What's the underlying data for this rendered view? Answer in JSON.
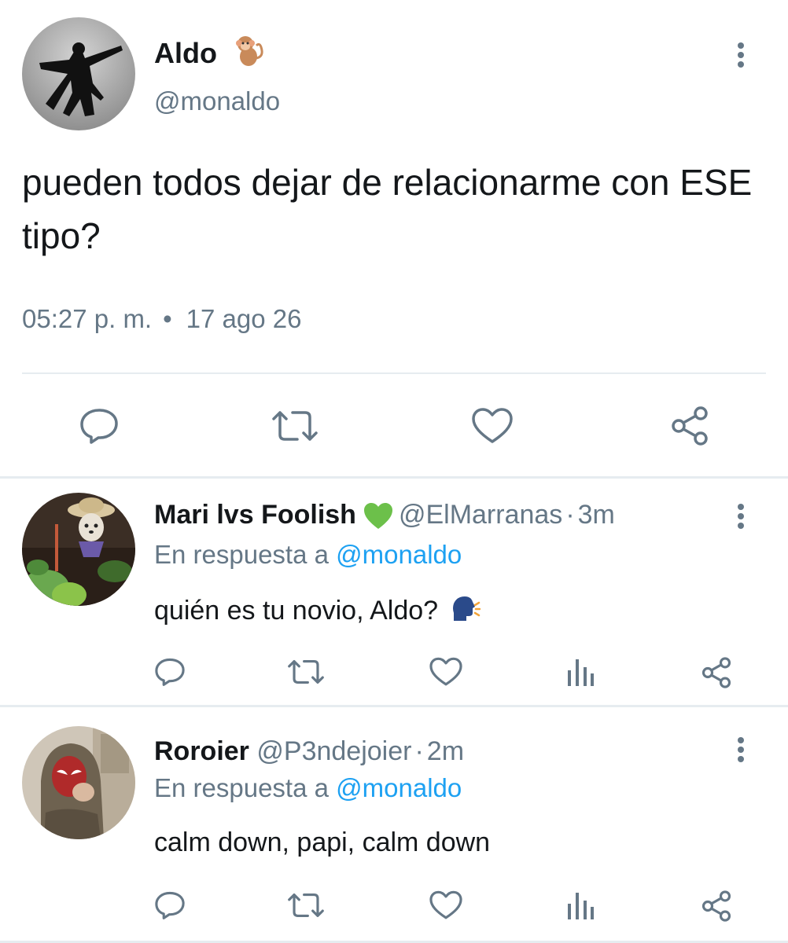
{
  "main_tweet": {
    "author_name": "Aldo",
    "author_emoji": "monkey-emoji",
    "author_handle": "@monaldo",
    "text": "pueden todos dejar de relacionarme con ESE tipo?",
    "time": "05:27 p. m.",
    "separator": "•",
    "date": "17 ago 26",
    "actions": [
      "reply-icon",
      "retweet-icon",
      "like-icon",
      "share-icon"
    ]
  },
  "replies": [
    {
      "author_name": "Mari lvs Foolish",
      "author_emoji": "green-heart-emoji",
      "author_handle": "@ElMarranas",
      "separator": "·",
      "time": "3m",
      "in_reply_prefix": "En respuesta a",
      "in_reply_mention": "@monaldo",
      "text": "quién es tu novio, Aldo?",
      "text_emoji": "speaking-head-emoji",
      "actions": [
        "reply-icon",
        "retweet-icon",
        "like-icon",
        "stats-icon",
        "share-icon"
      ]
    },
    {
      "author_name": "Roroier",
      "author_handle": "@P3ndejoier",
      "separator": "·",
      "time": "2m",
      "in_reply_prefix": "En respuesta a",
      "in_reply_mention": "@monaldo",
      "text": "calm down, papi, calm down",
      "actions": [
        "reply-icon",
        "retweet-icon",
        "like-icon",
        "stats-icon",
        "share-icon"
      ]
    }
  ],
  "colors": {
    "text_primary": "#14171a",
    "text_secondary": "#657786",
    "link": "#1da1f2",
    "divider": "#e6ecf0",
    "icon": "#657786"
  }
}
